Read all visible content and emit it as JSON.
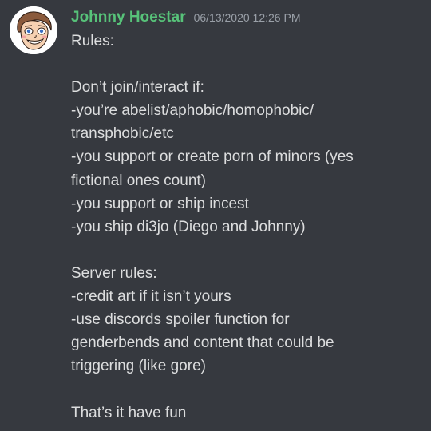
{
  "message": {
    "author": {
      "name": "Johnny Hoestar",
      "name_color": "#57c279",
      "avatar_icon": "cartoon-face-avatar"
    },
    "timestamp": "06/13/2020 12:26 PM",
    "lines": [
      "Rules:",
      "",
      "Don’t join/interact if:",
      "-you’re abelist/aphobic/homophobic/",
      "transphobic/etc",
      "-you support or create porn of minors (yes",
      "fictional ones count)",
      "-you support or ship incest",
      "-you ship di3jo (Diego and Johnny)",
      "",
      "Server rules:",
      "-credit art if it isn’t yours",
      "-use discords spoiler function for",
      "genderbends and content that could be",
      "triggering (like gore)",
      "",
      "That’s it have fun"
    ]
  },
  "theme": {
    "background": "#36393f",
    "text": "#dcddde",
    "timestamp": "#9aa0a8"
  }
}
